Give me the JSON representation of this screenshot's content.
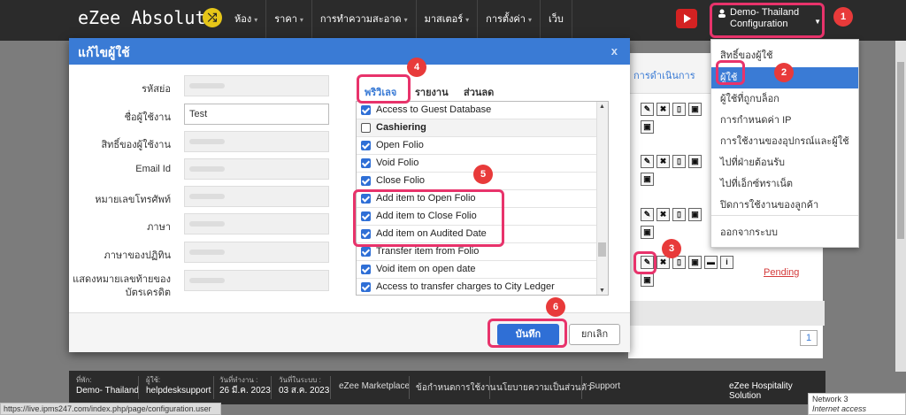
{
  "header": {
    "logo": "eZee Absolute",
    "nav": [
      "ห้อง",
      "ราคา",
      "การทำความสะอาด",
      "มาสเตอร์",
      "การตั้งค่า",
      "เว็บ"
    ],
    "hotel_line1": "Demo- Thailand",
    "hotel_line2": "Configuration"
  },
  "dropdown": {
    "items": [
      "สิทธิ์ของผู้ใช้",
      "ผู้ใช้",
      "ผู้ใช้ที่ถูกบล็อก",
      "การกำหนดค่า IP",
      "การใช้งานของอุปกรณ์และผู้ใช้",
      "ไปที่ฝ่ายต้อนรับ",
      "ไปที่เอ็กซ์ทราเน็ต",
      "ปิดการใช้งานของลูกค้า"
    ],
    "logout": "ออกจากระบบ",
    "active_index": 1
  },
  "background": {
    "actions_header": "การดำเนินการ",
    "pending": "Pending",
    "page": "1"
  },
  "modal": {
    "title": "แก้ไขผู้ใช้",
    "close": "x",
    "labels": [
      "รหัสย่อ",
      "ชื่อผู้ใช้งาน",
      "สิทธิ์ของผู้ใช้งาน",
      "Email Id",
      "หมายเลขโทรศัพท์",
      "ภาษา",
      "ภาษาของปฏิทิน"
    ],
    "card_label_1": "แสดงหมายเลขท้ายของ",
    "card_label_2": "บัตรเครดิต",
    "username_value": "Test",
    "tabs": [
      "พริวิเลจ",
      "รายงาน",
      "ส่วนลด"
    ],
    "privileges": [
      {
        "label": "Access to Guest Database",
        "checked": true,
        "group": false
      },
      {
        "label": "Cashiering",
        "checked": false,
        "group": true
      },
      {
        "label": "Open Folio",
        "checked": true,
        "group": false
      },
      {
        "label": "Void Folio",
        "checked": true,
        "group": false
      },
      {
        "label": "Close Folio",
        "checked": true,
        "group": false
      },
      {
        "label": "Add item to Open Folio",
        "checked": true,
        "group": false
      },
      {
        "label": "Add item to Close Folio",
        "checked": true,
        "group": false
      },
      {
        "label": "Add item on Audited Date",
        "checked": true,
        "group": false
      },
      {
        "label": "Transfer item from Folio",
        "checked": true,
        "group": false
      },
      {
        "label": "Void item on open date",
        "checked": true,
        "group": false
      },
      {
        "label": "Access to transfer charges to City Ledger",
        "checked": true,
        "group": false
      }
    ],
    "save": "บันทึก",
    "cancel": "ยกเลิก"
  },
  "footer": {
    "hotel_lbl": "ที่พัก:",
    "hotel": "Demo- Thailand",
    "user_lbl": "ผู้ใช้:",
    "user": "helpdesksupport",
    "workdate_lbl": "วันที่ทำงาน :",
    "workdate": "26 มี.ค. 2023",
    "sysdate_lbl": "วันที่ในระบบ :",
    "sysdate": "03 ส.ค. 2023",
    "links": [
      "eZee Marketplace",
      "ข้อกำหนดการใช้งาน",
      "นโยบายความเป็นส่วนตัว",
      "Support"
    ],
    "brand": "eZee Hospitality Solution"
  },
  "status_url": "https://live.ipms247.com/index.php/page/configuration.user",
  "network": {
    "line1": "Network 3",
    "line2": "Internet access"
  },
  "callouts": [
    "1",
    "2",
    "3",
    "4",
    "5",
    "6"
  ],
  "colors": {
    "accent": "#3a7bd5",
    "highlight": "#e8336b",
    "badge": "#e83a3a"
  }
}
